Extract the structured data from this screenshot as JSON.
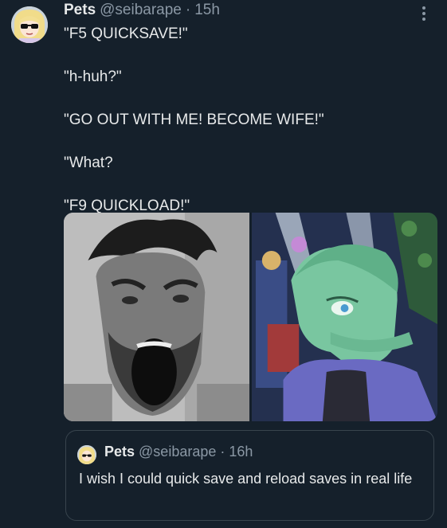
{
  "post": {
    "display_name": "Pets",
    "handle": "@seibarape",
    "separator": "·",
    "time": "15h",
    "lines": [
      "\"F5 QUICKSAVE!\"",
      "\"h-huh?\"",
      "\"GO OUT WITH ME! BECOME WIFE!\"",
      "\"What?",
      "\"F9 QUICKLOAD!\""
    ]
  },
  "quoted_post": {
    "display_name": "Pets",
    "handle": "@seibarape",
    "separator": "·",
    "time": "16h",
    "text": "I wish I could quick save and reload saves in real life"
  },
  "colors": {
    "background": "#15202b",
    "text_primary": "#e7e9ea",
    "text_secondary": "#8b98a5",
    "border": "#38444d"
  },
  "icons": {
    "more": "more-dots-icon",
    "avatar": "avatar-anime-girl-sunglasses"
  }
}
